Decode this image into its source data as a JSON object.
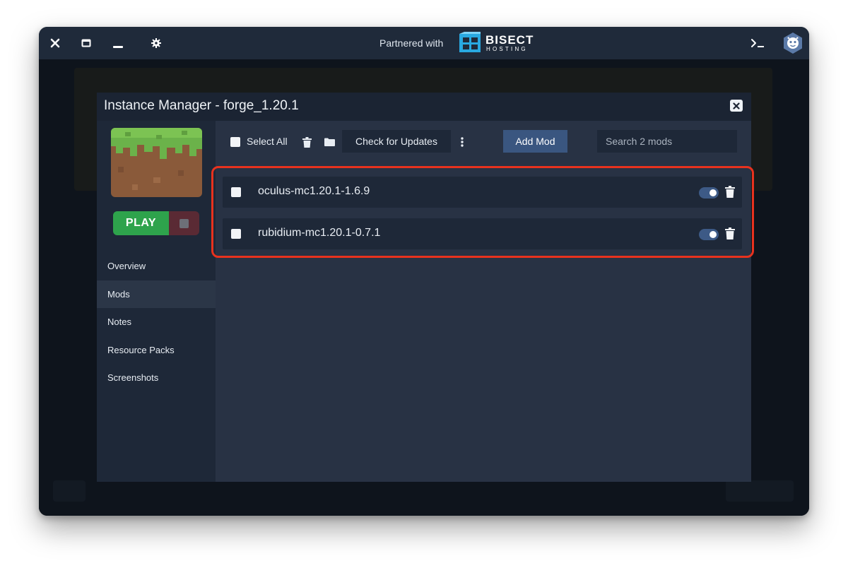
{
  "titlebar": {
    "partner_text": "Partnered with",
    "bisect_name": "BISECT",
    "bisect_sub": "HOSTING",
    "icons": [
      "close-icon",
      "maximize-icon",
      "minimize-icon",
      "settings-icon",
      "terminal-icon",
      "profile-avatar-icon"
    ]
  },
  "modal": {
    "title": "Instance Manager - forge_1.20.1",
    "play_label": "PLAY",
    "nav": [
      {
        "label": "Overview",
        "active": false
      },
      {
        "label": "Mods",
        "active": true
      },
      {
        "label": "Notes",
        "active": false
      },
      {
        "label": "Resource Packs",
        "active": false
      },
      {
        "label": "Screenshots",
        "active": false
      }
    ],
    "toolbar": {
      "select_all": "Select All",
      "check_updates": "Check for Updates",
      "add_mod": "Add Mod",
      "search_placeholder": "Search 2 mods"
    },
    "mods": [
      {
        "name": "oculus-mc1.20.1-1.6.9",
        "enabled": true
      },
      {
        "name": "rubidium-mc1.20.1-0.7.1",
        "enabled": true
      }
    ]
  },
  "colors": {
    "accent": "#3a5680",
    "play_green": "#2ea34c",
    "highlight_red": "#e8321e",
    "bisect_cyan": "#29a9e1"
  }
}
